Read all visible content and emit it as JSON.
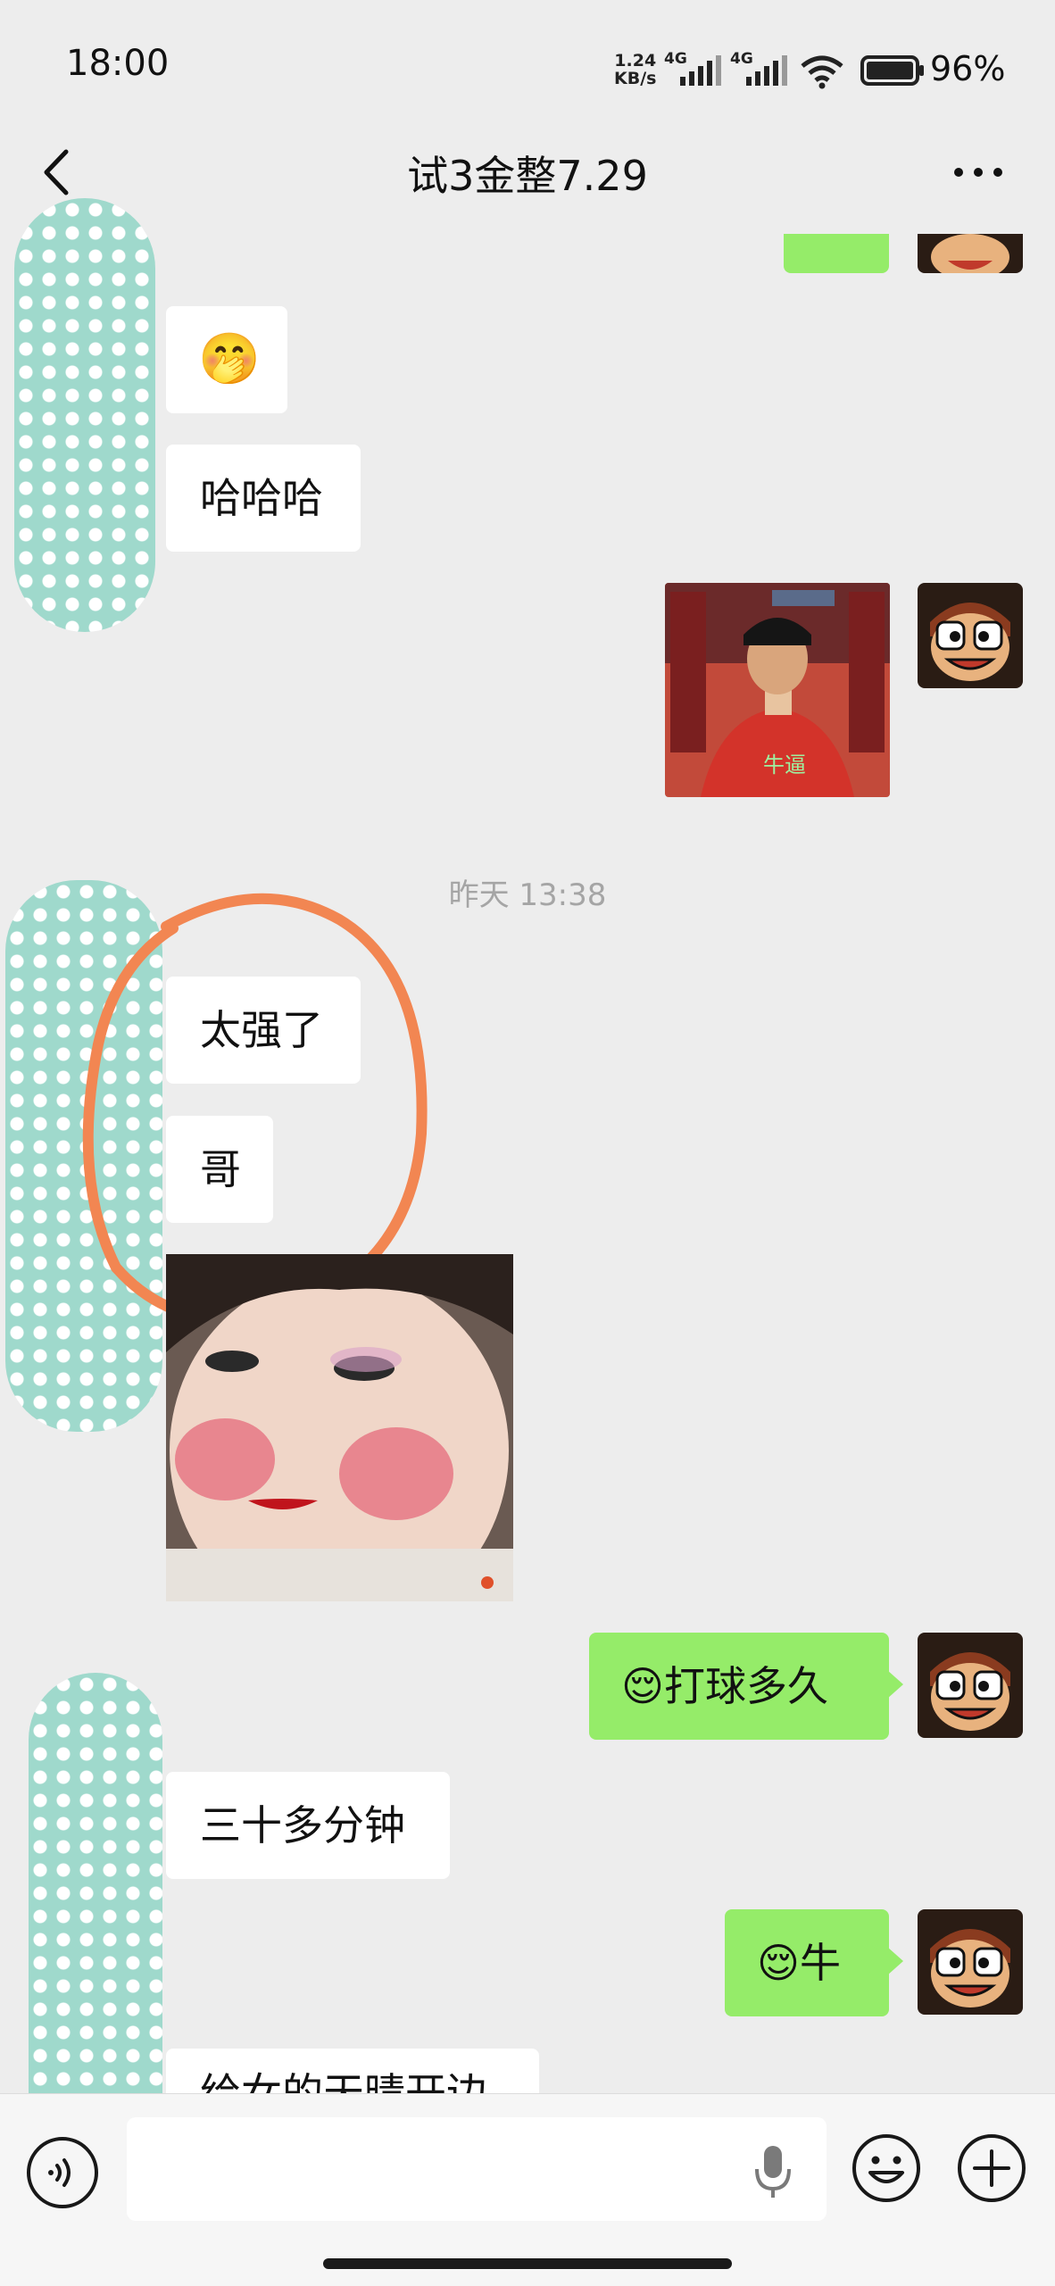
{
  "status": {
    "time": "18:00",
    "net_speed_value": "1.24",
    "net_speed_unit": "KB/s",
    "signal1_label": "4G",
    "signal2_label": "4G",
    "battery": "96%"
  },
  "header": {
    "title": "试3金整7.29",
    "back_icon": "chevron-left-icon",
    "more_icon": "more-dots-icon"
  },
  "messages": {
    "in_emoji": "🤭",
    "in_haha": "哈哈哈",
    "timestamp": "昨天 13:38",
    "in_taiqiang": "太强了",
    "in_ge": "哥",
    "out_daqiu_emoji": "😌",
    "out_daqiu_text": "打球多久",
    "in_sanshi": "三十多分钟",
    "out_niu_emoji": "😌",
    "out_niu_text": "牛",
    "in_partial": "给女的天晴开边"
  },
  "input": {
    "placeholder": "",
    "voice_icon": "voice-toggle-icon",
    "mic_icon": "microphone-icon",
    "emoji_icon": "emoji-icon",
    "plus_icon": "plus-icon"
  },
  "colors": {
    "sent_bubble": "#95ec69",
    "received_bubble": "#ffffff",
    "background": "#ededed",
    "annotation_circle": "#f28652"
  }
}
